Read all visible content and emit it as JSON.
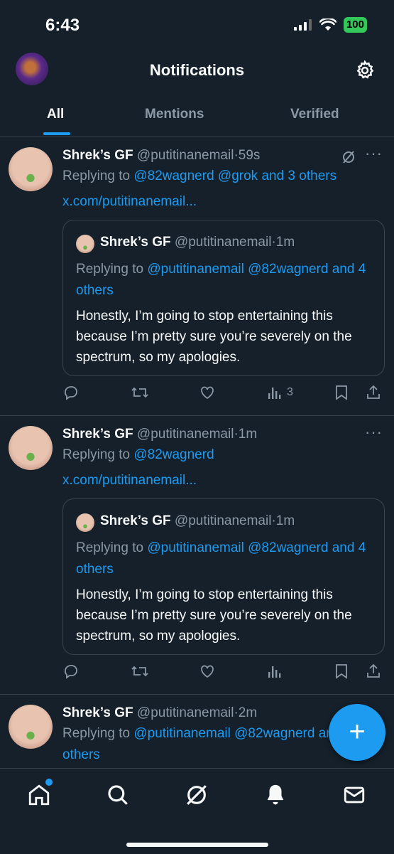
{
  "status": {
    "time": "6:43",
    "battery": "100"
  },
  "header": {
    "title": "Notifications"
  },
  "tabs": [
    {
      "label": "All"
    },
    {
      "label": "Mentions"
    },
    {
      "label": "Verified"
    }
  ],
  "tweets": [
    {
      "name": "Shrek’s GF",
      "handle": "@putitinanemail",
      "time": "·59s",
      "replying_prefix": "Replying to ",
      "replying_links": "@82wagnerd @grok and 3 others",
      "url": "x.com/putitinanemail...",
      "quote": {
        "name": "Shrek’s GF",
        "handle": "@putitinanemail",
        "time": "·1m",
        "replying_prefix": "Replying to ",
        "replying_links": "@putitinanemail @82wagnerd and 4 others",
        "text": "Honestly, I’m going to stop entertaining this because I’m pretty sure you’re severely on the spectrum, so my apologies."
      },
      "views": "3"
    },
    {
      "name": "Shrek’s GF",
      "handle": "@putitinanemail",
      "time": "·1m",
      "replying_prefix": "Replying to ",
      "replying_links": "@82wagnerd",
      "url": "x.com/putitinanemail...",
      "quote": {
        "name": "Shrek’s GF",
        "handle": "@putitinanemail",
        "time": "·1m",
        "replying_prefix": "Replying to ",
        "replying_links": "@putitinanemail @82wagnerd and 4 others",
        "text": "Honestly, I’m going to stop entertaining this because I’m pretty sure you’re severely on the spectrum, so my apologies."
      },
      "views": ""
    },
    {
      "name": "Shrek’s GF",
      "handle": "@putitinanemail",
      "time": "·2m",
      "replying_prefix": "Replying to ",
      "replying_links": "@putitinanemail @82wagnerd and 4 others"
    }
  ],
  "colors": {
    "background": "#15202b",
    "accent": "#1d9bf0",
    "muted": "#8b98a5",
    "divider": "#38444d"
  },
  "icons": [
    "signal-icon",
    "wifi-icon",
    "gear-icon",
    "grok-icon",
    "reply-icon",
    "retweet-icon",
    "like-icon",
    "views-icon",
    "bookmark-icon",
    "share-icon",
    "home-icon",
    "search-icon",
    "bell-icon",
    "mail-icon",
    "compose-icon"
  ]
}
